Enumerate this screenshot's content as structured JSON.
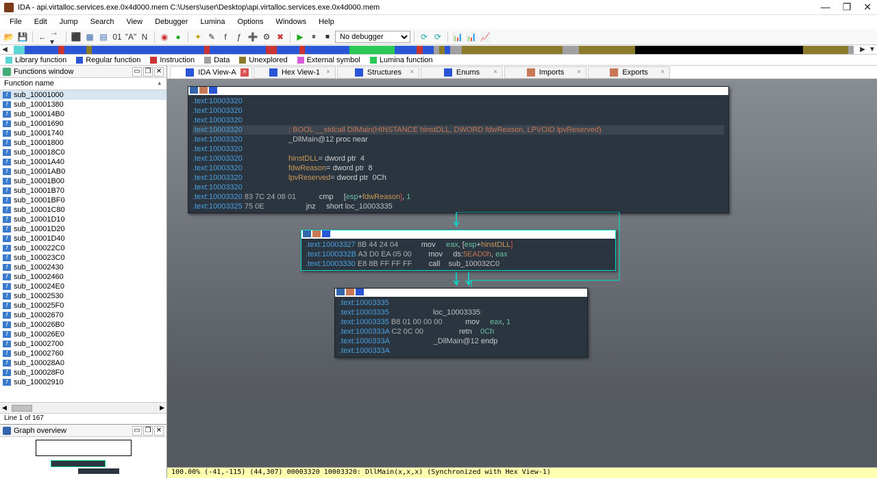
{
  "titlebar": {
    "title": "IDA - api.virtalloc.services.exe.0x4d000.mem C:\\Users\\user\\Desktop\\api.virtalloc.services.exe.0x4d000.mem"
  },
  "menu": [
    "File",
    "Edit",
    "Jump",
    "Search",
    "View",
    "Debugger",
    "Lumina",
    "Options",
    "Windows",
    "Help"
  ],
  "toolbar": {
    "debugger_select": "No debugger"
  },
  "legend": [
    {
      "color": "#5bd6d6",
      "label": "Library function"
    },
    {
      "color": "#2a55d6",
      "label": "Regular function"
    },
    {
      "color": "#c83333",
      "label": "Instruction"
    },
    {
      "color": "#a0a0a0",
      "label": "Data"
    },
    {
      "color": "#8a7a2a",
      "label": "Unexplored"
    },
    {
      "color": "#d65bd6",
      "label": "External symbol"
    },
    {
      "color": "#2ac855",
      "label": "Lumina function"
    }
  ],
  "nav_segments": [
    {
      "c": "#5bd6d6",
      "w": 2
    },
    {
      "c": "#2a55d6",
      "w": 6
    },
    {
      "c": "#c83333",
      "w": 1
    },
    {
      "c": "#2a55d6",
      "w": 4
    },
    {
      "c": "#8a7a2a",
      "w": 1
    },
    {
      "c": "#2a55d6",
      "w": 20
    },
    {
      "c": "#c83333",
      "w": 1
    },
    {
      "c": "#2a55d6",
      "w": 10
    },
    {
      "c": "#c83333",
      "w": 2
    },
    {
      "c": "#2a55d6",
      "w": 4
    },
    {
      "c": "#c83333",
      "w": 1
    },
    {
      "c": "#2a55d6",
      "w": 8
    },
    {
      "c": "#2ac855",
      "w": 8
    },
    {
      "c": "#2a55d6",
      "w": 4
    },
    {
      "c": "#c83333",
      "w": 1
    },
    {
      "c": "#2a55d6",
      "w": 2
    },
    {
      "c": "#a0a0a0",
      "w": 1
    },
    {
      "c": "#8a7a2a",
      "w": 1
    },
    {
      "c": "#2a55d6",
      "w": 1
    },
    {
      "c": "#a0a0a0",
      "w": 2
    },
    {
      "c": "#8a7a2a",
      "w": 18
    },
    {
      "c": "#a0a0a0",
      "w": 3
    },
    {
      "c": "#8a7a2a",
      "w": 10
    },
    {
      "c": "#000000",
      "w": 30
    },
    {
      "c": "#8a7a2a",
      "w": 8
    },
    {
      "c": "#a0a0a0",
      "w": 1
    }
  ],
  "functions_panel": {
    "title": "Functions window",
    "column": "Function name",
    "status": "Line 1 of 167",
    "items": [
      "sub_10001000",
      "sub_10001380",
      "sub_100014B0",
      "sub_10001690",
      "sub_10001740",
      "sub_10001800",
      "sub_100018C0",
      "sub_10001A40",
      "sub_10001AB0",
      "sub_10001B00",
      "sub_10001B70",
      "sub_10001BF0",
      "sub_10001C80",
      "sub_10001D10",
      "sub_10001D20",
      "sub_10001D40",
      "sub_100022C0",
      "sub_100023C0",
      "sub_10002430",
      "sub_10002460",
      "sub_100024E0",
      "sub_10002530",
      "sub_100025F0",
      "sub_10002670",
      "sub_100026B0",
      "sub_100026E0",
      "sub_10002700",
      "sub_10002760",
      "sub_100028A0",
      "sub_100028F0",
      "sub_10002910"
    ]
  },
  "graph_overview": {
    "title": "Graph overview"
  },
  "tabs": [
    {
      "label": "IDA View-A",
      "active": true,
      "color": "#2a55d6",
      "close_color": "#d85050"
    },
    {
      "label": "Hex View-1",
      "active": false,
      "color": "#2a55d6"
    },
    {
      "label": "Structures",
      "active": false,
      "color": "#2a55d6"
    },
    {
      "label": "Enums",
      "active": false,
      "color": "#2a55d6"
    },
    {
      "label": "Imports",
      "active": false,
      "color": "#c87854"
    },
    {
      "label": "Exports",
      "active": false,
      "color": "#c87854"
    }
  ],
  "node1": {
    "lines": [
      [
        [
          "loc",
          ".text:"
        ],
        [
          "addr",
          "10003320"
        ]
      ],
      [
        [
          "loc",
          ".text:"
        ],
        [
          "addr",
          "10003320"
        ]
      ],
      [
        [
          "loc",
          ".text:"
        ],
        [
          "addr",
          "10003320"
        ]
      ],
      [
        [
          "loc",
          ".text:"
        ],
        [
          "addr",
          "10003320"
        ],
        [
          "plain",
          "                      "
        ],
        [
          "comment",
          "; BOOL __stdcall DllMain(HINSTANCE hinstDLL, DWORD fdwReason, LPVOID lpvReserved)"
        ]
      ],
      [
        [
          "loc",
          ".text:"
        ],
        [
          "addr",
          "10003320"
        ],
        [
          "plain",
          "                      "
        ],
        [
          "name",
          "_DllMain@12 "
        ],
        [
          "kw",
          "proc near"
        ]
      ],
      [
        [
          "loc",
          ".text:"
        ],
        [
          "addr",
          "10003320"
        ]
      ],
      [
        [
          "loc",
          ".text:"
        ],
        [
          "addr",
          "10003320"
        ],
        [
          "plain",
          "                      "
        ],
        [
          "label",
          "hinstDLL"
        ],
        [
          "kw",
          "= dword ptr  4"
        ]
      ],
      [
        [
          "loc",
          ".text:"
        ],
        [
          "addr",
          "10003320"
        ],
        [
          "plain",
          "                      "
        ],
        [
          "label",
          "fdwReason"
        ],
        [
          "kw",
          "= dword ptr  8"
        ]
      ],
      [
        [
          "loc",
          ".text:"
        ],
        [
          "addr",
          "10003320"
        ],
        [
          "plain",
          "                      "
        ],
        [
          "label",
          "lpvReserved"
        ],
        [
          "kw",
          "= dword ptr  0Ch"
        ]
      ],
      [
        [
          "loc",
          ".text:"
        ],
        [
          "addr",
          "10003320"
        ]
      ],
      [
        [
          "loc",
          ".text:"
        ],
        [
          "addr",
          "10003320"
        ],
        [
          "hex",
          " 83 7C 24 08 01"
        ],
        [
          "plain",
          "           "
        ],
        [
          "mnem",
          "cmp     "
        ],
        [
          "kw",
          "["
        ],
        [
          "reg",
          "esp"
        ],
        [
          "kw",
          "+"
        ],
        [
          "label",
          "fdwReason"
        ],
        [
          "red",
          "]"
        ],
        [
          "kw",
          ", "
        ],
        [
          "num",
          "1"
        ]
      ],
      [
        [
          "loc",
          ".text:"
        ],
        [
          "addr",
          "10003325"
        ],
        [
          "hex",
          " 75 0E"
        ],
        [
          "plain",
          "                    "
        ],
        [
          "mnem",
          "jnz     "
        ],
        [
          "kw",
          "short "
        ],
        [
          "name",
          "loc_10003335"
        ]
      ]
    ]
  },
  "node2": {
    "lines": [
      [
        [
          "loc",
          ".text:"
        ],
        [
          "addr",
          "10003327"
        ],
        [
          "hex",
          " 8B 44 24 04"
        ],
        [
          "plain",
          "           "
        ],
        [
          "mnem",
          "mov     "
        ],
        [
          "reg",
          "eax"
        ],
        [
          "kw",
          ", ["
        ],
        [
          "reg",
          "esp"
        ],
        [
          "kw",
          "+"
        ],
        [
          "label",
          "hinstDLL"
        ],
        [
          "red",
          "]"
        ]
      ],
      [
        [
          "loc",
          ".text:"
        ],
        [
          "addr",
          "1000332B"
        ],
        [
          "hex",
          " A3 D0 EA 05 00"
        ],
        [
          "plain",
          "        "
        ],
        [
          "mnem",
          "mov     "
        ],
        [
          "kw",
          "ds:"
        ],
        [
          "brown",
          "5EAD0h"
        ],
        [
          "kw",
          ", "
        ],
        [
          "reg",
          "eax"
        ]
      ],
      [
        [
          "loc",
          ".text:"
        ],
        [
          "addr",
          "10003330"
        ],
        [
          "hex",
          " E8 8B FF FF FF"
        ],
        [
          "plain",
          "        "
        ],
        [
          "mnem",
          "call    "
        ],
        [
          "name",
          "sub_100032C0"
        ]
      ]
    ]
  },
  "node3": {
    "lines": [
      [
        [
          "loc",
          ".text:"
        ],
        [
          "addr",
          "10003335"
        ]
      ],
      [
        [
          "loc",
          ".text:"
        ],
        [
          "addr",
          "10003335"
        ],
        [
          "plain",
          "                     "
        ],
        [
          "name",
          "loc_10003335"
        ],
        [
          "brown",
          ":"
        ]
      ],
      [
        [
          "loc",
          ".text:"
        ],
        [
          "addr",
          "10003335"
        ],
        [
          "hex",
          " B8 01 00 00 00"
        ],
        [
          "plain",
          "           "
        ],
        [
          "mnem",
          "mov     "
        ],
        [
          "reg",
          "eax"
        ],
        [
          "kw",
          ", "
        ],
        [
          "num",
          "1"
        ]
      ],
      [
        [
          "loc",
          ".text:"
        ],
        [
          "addr",
          "1000333A"
        ],
        [
          "hex",
          " C2 0C 00"
        ],
        [
          "plain",
          "                 "
        ],
        [
          "mnem",
          "retn    "
        ],
        [
          "num",
          "0Ch"
        ]
      ],
      [
        [
          "loc",
          ".text:"
        ],
        [
          "addr",
          "1000333A"
        ],
        [
          "plain",
          "                     "
        ],
        [
          "name",
          "_DllMain@12 "
        ],
        [
          "kw",
          "endp"
        ]
      ],
      [
        [
          "loc",
          ".text:"
        ],
        [
          "addr",
          "1000333A"
        ]
      ]
    ]
  },
  "bottom_status": "100.00% (-41,-115) (44,307) 00003320 10003320: DllMain(x,x,x) (Synchronized with Hex View-1)"
}
